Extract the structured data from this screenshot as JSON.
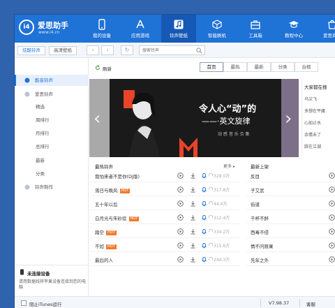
{
  "app": {
    "brand": "爱思助手",
    "url": "www.i4.cn",
    "logo_text": "i4"
  },
  "nav": [
    {
      "label": "我的设备",
      "icon": "phone-icon"
    },
    {
      "label": "应用游戏",
      "icon": "appstore-icon"
    },
    {
      "label": "铃声壁纸",
      "icon": "music-icon",
      "active": true
    },
    {
      "label": "智能刷机",
      "icon": "box-icon"
    },
    {
      "label": "工具箱",
      "icon": "toolbox-icon"
    },
    {
      "label": "教程中心",
      "icon": "graduation-cap-icon"
    },
    {
      "label": "爱思商城",
      "icon": "shop-icon"
    }
  ],
  "toolbar": {
    "tabs": [
      "炫酷铃声",
      "高清壁纸"
    ],
    "back": "‹",
    "forward": "›",
    "reload": "↻",
    "search_placeholder": "搜索铃声"
  },
  "sidebar": {
    "items": [
      {
        "label": "酷音铃声",
        "type": "header",
        "active": true
      },
      {
        "label": "爱思铃声",
        "type": "header"
      },
      {
        "label": "精选",
        "type": "sub"
      },
      {
        "label": "周排行",
        "type": "sub"
      },
      {
        "label": "月排行",
        "type": "sub"
      },
      {
        "label": "总排行",
        "type": "sub"
      },
      {
        "label": "最新",
        "type": "sub"
      },
      {
        "label": "分类",
        "type": "sub"
      },
      {
        "label": "铃声制作",
        "type": "header"
      }
    ],
    "device_title": "未连接设备",
    "device_desc": "请用数据线将苹果设备连接到您的电脑"
  },
  "content": {
    "refresh_label": "刷新",
    "filter_tabs": [
      "首页",
      "最热",
      "最新",
      "分类",
      "台榜"
    ],
    "banner": {
      "title": "令人心“动”的",
      "subtitle": "——·英文旋律",
      "footer": "动 感 音 乐 合 集"
    },
    "side_panel": {
      "title": "大家都在搜",
      "items": [
        "乌兰飞",
        "多想在平庸",
        "心如止水",
        "余情未了",
        "踩在江湖"
      ]
    },
    "hot_title": "最热铃声",
    "more_label": "更多",
    "new_title": "最新上架",
    "hot_list": [
      {
        "name": "我怕来者不是你(DJ版)",
        "hot": false,
        "count": "328.0万"
      },
      {
        "name": "落日与晚风",
        "hot": true,
        "count": "317.8万"
      },
      {
        "name": "五十年以后",
        "hot": false,
        "count": "44.4万"
      },
      {
        "name": "白月光与朱砂痣",
        "hot": true,
        "count": "312.4万"
      },
      {
        "name": "踏空",
        "hot": true,
        "count": "334.2万"
      },
      {
        "name": "不如",
        "hot": true,
        "count": "315.6万"
      },
      {
        "name": "最后的人",
        "hot": false,
        "count": "244.3万"
      }
    ],
    "hot_badge": "HOT",
    "new_list": [
      "反目",
      "子艾武",
      "街道",
      "千杯不醉",
      "西毒不侵",
      "情不问原果",
      "先年之外"
    ]
  },
  "statusbar": {
    "itunes_label": "阻止iTunes运行",
    "version": "V7.98.37",
    "feedback": "客服"
  },
  "colors": {
    "brand_blue": "#1f72d6",
    "hot_orange": "#f07a2f",
    "banner_red": "#e8442a"
  }
}
